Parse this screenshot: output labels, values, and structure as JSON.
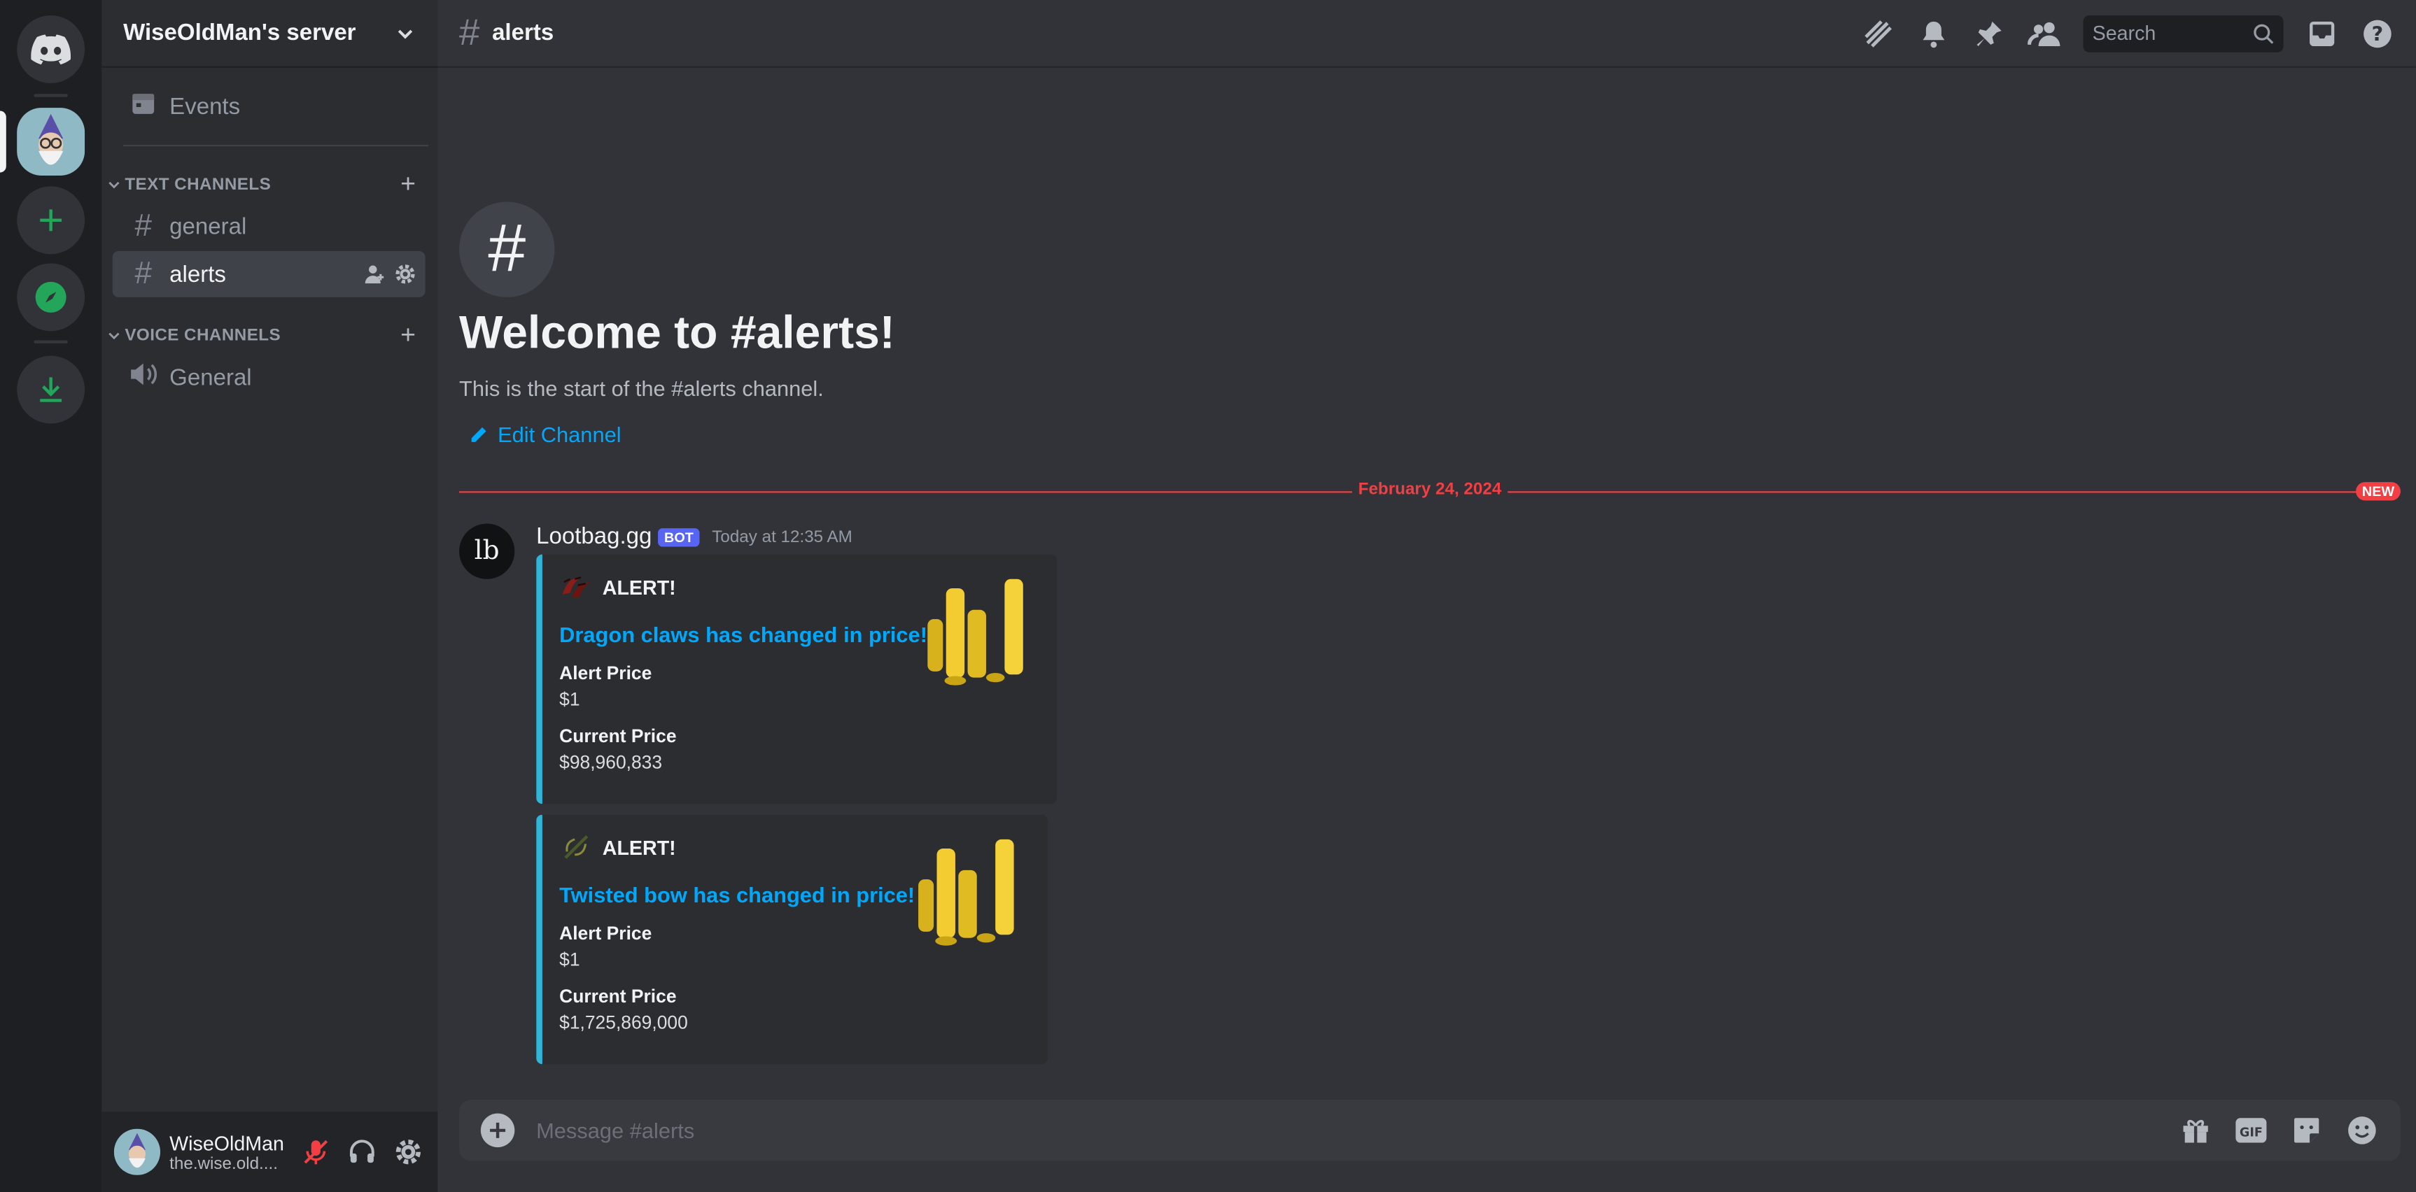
{
  "server": {
    "name": "WiseOldMan's server"
  },
  "sidebar": {
    "events_label": "Events",
    "text_category": "TEXT CHANNELS",
    "voice_category": "VOICE CHANNELS",
    "text_channels": [
      {
        "label": "general"
      },
      {
        "label": "alerts"
      }
    ],
    "voice_channels": [
      {
        "label": "General"
      }
    ]
  },
  "user": {
    "name": "WiseOldMan",
    "tag": "the.wise.old...."
  },
  "channel": {
    "name": "alerts",
    "search_placeholder": "Search",
    "welcome_title": "Welcome to #alerts!",
    "welcome_sub": "This is the start of the #alerts channel.",
    "edit_label": "Edit Channel"
  },
  "divider": {
    "date": "February 24, 2024",
    "new_label": "NEW"
  },
  "message": {
    "avatar_text": "lb",
    "author": "Lootbag.gg",
    "bot_label": "BOT",
    "timestamp": "Today at 12:35 AM",
    "embeds": [
      {
        "author": "ALERT!",
        "title": "Dragon claws has changed in price!",
        "fields": [
          {
            "name": "Alert Price",
            "value": "$1"
          },
          {
            "name": "Current Price",
            "value": "$98,960,833"
          }
        ]
      },
      {
        "author": "ALERT!",
        "title": "Twisted bow has changed in price!",
        "fields": [
          {
            "name": "Alert Price",
            "value": "$1"
          },
          {
            "name": "Current Price",
            "value": "$1,725,869,000"
          }
        ]
      }
    ]
  },
  "composer": {
    "placeholder": "Message #alerts"
  },
  "colors": {
    "accent": "#5865f2",
    "link": "#00a8fc",
    "embed_border": "#30b5d8",
    "new": "#f23f43",
    "green": "#23a55a"
  }
}
